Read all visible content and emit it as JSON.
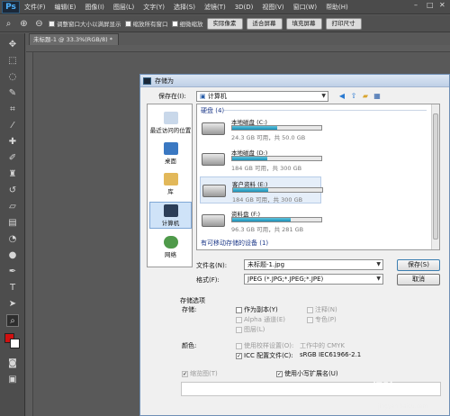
{
  "app": {
    "logo": "Ps"
  },
  "menu": [
    "文件(F)",
    "编辑(E)",
    "图像(I)",
    "图层(L)",
    "文字(Y)",
    "选择(S)",
    "滤镜(T)",
    "3D(D)",
    "视图(V)",
    "窗口(W)",
    "帮助(H)"
  ],
  "options": {
    "resize_windows": "调整窗口大小以满屏显示",
    "zoom_all": "缩放所有窗口",
    "scrubby_zoom": "细微缩放",
    "actual_pixels": "实际像素",
    "fit_screen": "适合屏幕",
    "fill_screen": "填充屏幕",
    "print_size": "打印尺寸"
  },
  "doc_tab": "未标题-1 @ 33.3%(RGB/8) *",
  "dialog": {
    "title": "存储为",
    "save_in_label": "保存在(I):",
    "save_in_value": "计算机",
    "places": [
      "最近访问的位置",
      "桌面",
      "库",
      "计算机",
      "网络"
    ],
    "group_hdd": "硬盘 (4)",
    "drives": [
      {
        "name": "本地磁盘 (C:)",
        "size": "24.3 GB 可用，共 50.0 GB",
        "used": 0.51
      },
      {
        "name": "本地磁盘 (D:)",
        "size": "184 GB 可用，共 300 GB",
        "used": 0.39
      },
      {
        "name": "客户资料 (E:)",
        "size": "184 GB 可用，共 300 GB",
        "used": 0.39
      },
      {
        "name": "资料盘 (F:)",
        "size": "96.3 GB 可用，共 281 GB",
        "used": 0.66
      }
    ],
    "group_removable": "有可移动存储的设备 (1)",
    "filename_label": "文件名(N):",
    "filename_value": "未标题-1.jpg",
    "format_label": "格式(F):",
    "format_value": "JPEG (*.JPG;*.JPEG;*.JPE)",
    "save_button": "保存(S)",
    "cancel_button": "取消",
    "save_options_title": "存储选项",
    "save_label": "存储:",
    "as_copy": "作为副本(Y)",
    "annotations": "注释(N)",
    "alpha_channels": "Alpha 通道(E)",
    "spot_colors": "专色(P)",
    "layers": "图层(L)",
    "color_label": "颜色:",
    "use_proof": "使用校样设置(O):",
    "proof_value": "工作中的 CMYK",
    "icc_profile": "ICC 配置文件(C):",
    "icc_value": "sRGB IEC61966-2.1",
    "thumbnail": "缩览图(T)",
    "lowercase_ext": "使用小写扩展名(U)"
  },
  "watermark": {
    "main": "Bai 经验",
    "sub": "jingyan.baidu.com"
  }
}
